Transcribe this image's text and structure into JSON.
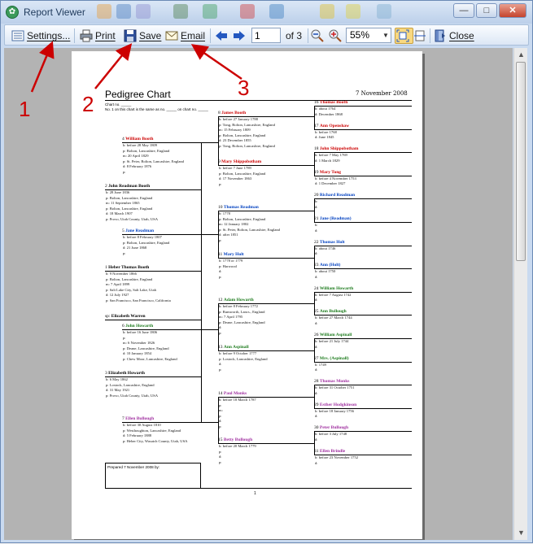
{
  "window": {
    "title": "Report Viewer"
  },
  "toolbar": {
    "settings": "Settings...",
    "print": "Print",
    "save": "Save",
    "email": "Email",
    "page_value": "1",
    "page_total": "of 3",
    "zoom": "55%",
    "close": "Close"
  },
  "report": {
    "title": "Pedigree Chart",
    "date": "7 November 2008",
    "chart_no": "Chart no. _____",
    "same_as": "No. 1 on this chart is the same as no. _____ on chart no. _____",
    "prepared": "Prepared 7 November 2008 by:",
    "page_number": "1",
    "persons": {
      "p1": {
        "num": "1",
        "name": "Heber Thomas Booth",
        "details": [
          "b: 9 November 1866",
          "p: Bolton, Lancashire, England",
          "m: 7 April 1899",
          "p: Salt Lake City, Salt Lake, Utah",
          "d: 12 July 1927",
          "p: San Francisco, San Francisco, California"
        ]
      },
      "sp": {
        "label": "sp:",
        "name": "Elizabeth Warren"
      },
      "p2": {
        "num": "2",
        "name": "John Readman Booth",
        "details": [
          "b: 28 June 1836",
          "p: Bolton, Lancashire, England",
          "m: 11 September 1865",
          "p: Bolton, Lancashire, England",
          "d: 18 March 1907",
          "p: Provo, Utah County, Utah, USA"
        ]
      },
      "p3": {
        "num": "3",
        "name": "Elizabeth Howarth",
        "details": [
          "b: 6 May 1862",
          "p: Lostock, Lancashire, England",
          "d: 31 May 1921",
          "p: Provo, Utah County, Utah, USA"
        ]
      },
      "p4": {
        "num": "4",
        "name": "William Booth",
        "details": [
          "b: before 28 May 1809",
          "p: Bolton, Lancashire, England",
          "m: 20 April 1829",
          "p: St. Peter, Bolton, Lancashire, England",
          "d: 8 February 1876",
          "p:"
        ]
      },
      "p5": {
        "num": "5",
        "name": "Jane Readman",
        "details": [
          "b: before 8 February 1807",
          "p: Bolton, Lancashire, England",
          "d: 21 June 1868",
          "p:"
        ]
      },
      "p6": {
        "num": "6",
        "name": "John Howarth",
        "details": [
          "b: before 16 June 1806",
          "p:",
          "m: 6 November 1826",
          "p: Deane, Lancashire, England",
          "d: 10 January 1854",
          "p: Chew Moor, Lancashire, England"
        ]
      },
      "p7": {
        "num": "7",
        "name": "Ellen Bullough",
        "details": [
          "b: before 30 August 1810",
          "p: Westhoughton, Lancashire, England",
          "d: 5 February 1888",
          "p: Heber City, Wasatch County, Utah, USA"
        ]
      },
      "p8": {
        "num": "8",
        "name": "James Booth",
        "details": [
          "b: before 27 January 1788",
          "p: Tong, Bolton, Lancashire, England",
          "m: 15 February 1809",
          "p: Bolton, Lancashire, England",
          "d: 23 December 1855",
          "p: Tong, Bolton, Lancashire, England"
        ]
      },
      "p9": {
        "num": "9",
        "name": "Mary Shippobotham",
        "details": [
          "b: before 7 June 1789",
          "p: Bolton, Lancashire, England",
          "d: 17 November 1863",
          "p:"
        ]
      },
      "p10": {
        "num": "10",
        "name": "Thomas Readman",
        "details": [
          "b: 1778",
          "p: Bolton, Lancashire, England",
          "m: 12 January 1802",
          "p: St. Peter, Bolton, Lancashire, England",
          "d: after 1851",
          "p:"
        ]
      },
      "p11": {
        "num": "11",
        "name": "Mary Holt",
        "details": [
          "b: 1778 or 1779",
          "p: Harwood",
          "d:",
          "p:"
        ]
      },
      "p12": {
        "num": "12",
        "name": "Adam Howarth",
        "details": [
          "b: before 8 February 1772",
          "p: Rumworth, Lancs., England",
          "m: 7 April 1795",
          "p: Deane, Lancashire, England",
          "d:",
          "p:"
        ]
      },
      "p13": {
        "num": "13",
        "name": "Ann Aspinall",
        "details": [
          "b: before 9 October 1777",
          "p: Lostock, Lancashire, England",
          "d:",
          "p:"
        ]
      },
      "p14": {
        "num": "14",
        "name": "Paul Monks",
        "details": [
          "b: before 18 March 1787",
          "p:",
          "m:",
          "p:",
          "d:",
          "p:"
        ]
      },
      "p15": {
        "num": "15",
        "name": "Betty Bullough",
        "details": [
          "b: before 20 March 1779",
          "p:",
          "d:",
          "p:"
        ]
      },
      "p16": {
        "num": "16",
        "name": "Thomas Booth",
        "details": [
          "b: about 1764",
          "d: December 1868"
        ]
      },
      "p17": {
        "num": "17",
        "name": "Ann Openshaw",
        "details": [
          "b: before 1768",
          "d: June 1845"
        ]
      },
      "p18": {
        "num": "18",
        "name": "John Shippobotham",
        "details": [
          "b: before 7 May 1769",
          "d: 1 March 1829"
        ]
      },
      "p19": {
        "num": "19",
        "name": "Mary Tong",
        "details": [
          "b: before 4 November 1753",
          "d: 1 December 1827"
        ]
      },
      "p20": {
        "num": "20",
        "name": "Richard Readman",
        "details": [
          "b:",
          "d:"
        ]
      },
      "p21": {
        "num": "21",
        "name": "Jane (Readman)",
        "details": [
          "b:",
          "d:"
        ]
      },
      "p22": {
        "num": "22",
        "name": "Thomas Holt",
        "details": [
          "b: about 1746",
          "d:"
        ]
      },
      "p23": {
        "num": "23",
        "name": "Ann (Holt)",
        "details": [
          "b: about 1750",
          "d:"
        ]
      },
      "p24": {
        "num": "24",
        "name": "William Howarth",
        "details": [
          "b: before 7 August 1742",
          "d:"
        ]
      },
      "p25": {
        "num": "25",
        "name": "Ann Bullough",
        "details": [
          "b: before 27 March 1744",
          "d:"
        ]
      },
      "p26": {
        "num": "26",
        "name": "William Aspinall",
        "details": [
          "b: before 21 July 1744",
          "d:"
        ]
      },
      "p27": {
        "num": "27",
        "name": "Mrs. (Aspinall)",
        "details": [
          "b: 1749",
          "d:"
        ]
      },
      "p28": {
        "num": "28",
        "name": "Thomas Monks",
        "details": [
          "b: before 31 October 1751",
          "d:"
        ]
      },
      "p29": {
        "num": "29",
        "name": "Esther Hodgkinson",
        "details": [
          "b: before 18 January 1756",
          "d:"
        ]
      },
      "p30": {
        "num": "30",
        "name": "Peter Bullough",
        "details": [
          "b: before 3 July 1748",
          "d:"
        ]
      },
      "p31": {
        "num": "31",
        "name": "Ellen Brindle",
        "details": [
          "b: before 23 November 1752",
          "d:"
        ]
      }
    }
  },
  "annotations": {
    "a1": "1",
    "a2": "2",
    "a3": "3"
  },
  "colors": {
    "arrow": "#cc0000",
    "male": "#0040c0",
    "female": "#cc0000",
    "green": "#1b7a1b",
    "purple": "#a030a0"
  }
}
